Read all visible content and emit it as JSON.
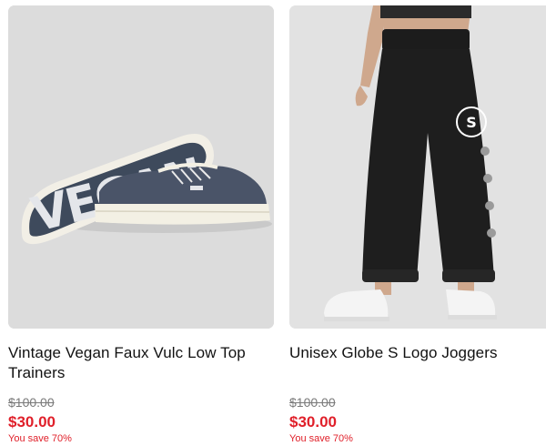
{
  "products": [
    {
      "title": "Vintage Vegan Faux Vulc Low Top Trainers",
      "original_price": "$100.00",
      "sale_price": "$30.00",
      "savings": "You save 70%",
      "image_label": "VEGAN"
    },
    {
      "title": "Unisex Globe S Logo Joggers",
      "original_price": "$100.00",
      "sale_price": "$30.00",
      "savings": "You save 70%"
    }
  ],
  "colors": {
    "sale": "#e0202a",
    "strike": "#7a7a7a"
  }
}
